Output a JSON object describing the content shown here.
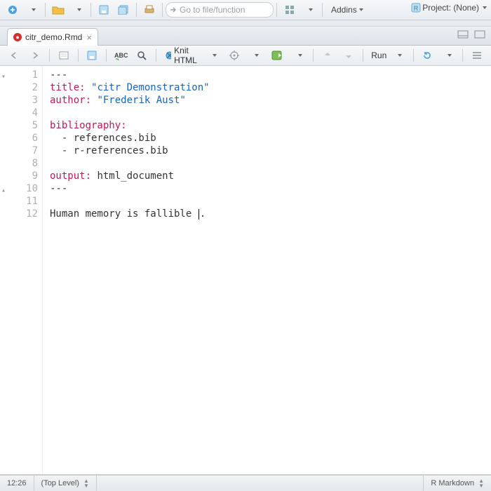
{
  "topbar": {
    "goto_placeholder": "Go to file/function",
    "addins_label": "Addins",
    "project_label": "Project: (None)"
  },
  "tab": {
    "filename": "citr_demo.Rmd"
  },
  "editorbar": {
    "knit_label": "Knit HTML",
    "run_label": "Run"
  },
  "lines": [
    {
      "n": "1",
      "fold": "▾",
      "segs": [
        {
          "t": "---",
          "c": ""
        }
      ]
    },
    {
      "n": "2",
      "segs": [
        {
          "t": "title:",
          "c": "kw"
        },
        {
          "t": " ",
          "c": ""
        },
        {
          "t": "\"citr Demonstration\"",
          "c": "str"
        }
      ]
    },
    {
      "n": "3",
      "segs": [
        {
          "t": "author:",
          "c": "kw"
        },
        {
          "t": " ",
          "c": ""
        },
        {
          "t": "\"Frederik Aust\"",
          "c": "str"
        }
      ]
    },
    {
      "n": "4",
      "segs": []
    },
    {
      "n": "5",
      "segs": [
        {
          "t": "bibliography:",
          "c": "kw"
        }
      ]
    },
    {
      "n": "6",
      "segs": [
        {
          "t": "  - references.bib",
          "c": ""
        }
      ]
    },
    {
      "n": "7",
      "segs": [
        {
          "t": "  - r-references.bib",
          "c": ""
        }
      ]
    },
    {
      "n": "8",
      "segs": []
    },
    {
      "n": "9",
      "segs": [
        {
          "t": "output:",
          "c": "kw"
        },
        {
          "t": " html_document",
          "c": ""
        }
      ]
    },
    {
      "n": "10",
      "fold": "▴",
      "segs": [
        {
          "t": "---",
          "c": ""
        }
      ]
    },
    {
      "n": "11",
      "segs": []
    },
    {
      "n": "12",
      "segs": [
        {
          "t": "Human memory is fallible ",
          "c": ""
        }
      ],
      "cursor": true,
      "tail": "."
    }
  ],
  "status": {
    "pos": "12:26",
    "scope": "(Top Level)",
    "mode": "R Markdown"
  }
}
